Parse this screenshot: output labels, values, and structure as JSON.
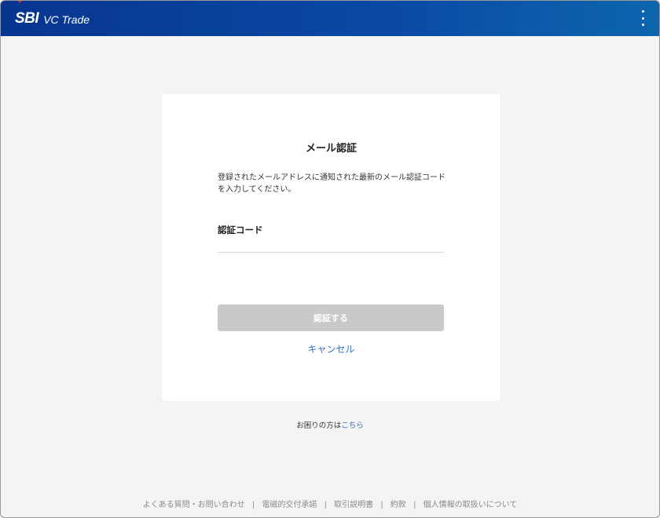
{
  "header": {
    "logo_mark": "SBI",
    "logo_text": "VC Trade",
    "colors": {
      "bar_start": "#07358f",
      "bar_end": "#0d66ad",
      "logo_arc": "#e8392f"
    },
    "menu_icon": "vertical-ellipsis-icon"
  },
  "card": {
    "title": "メール認証",
    "description": "登録されたメールアドレスに通知された最新のメール認証コードを入力してください。",
    "field_label": "認証コード",
    "code_value": "",
    "code_placeholder": "",
    "submit_label": "認証する",
    "cancel_label": "キャンセル"
  },
  "help": {
    "prefix": "お困りの方は",
    "link": "こちら"
  },
  "footer": {
    "links": [
      "よくある質問・お問い合わせ",
      "電磁的交付承諾",
      "取引説明書",
      "約款",
      "個人情報の取扱いについて"
    ],
    "separator": "|"
  },
  "colors": {
    "link": "#2f6fc0",
    "disabled_button": "#c9c9c9",
    "page_background": "#f4f4f4"
  }
}
